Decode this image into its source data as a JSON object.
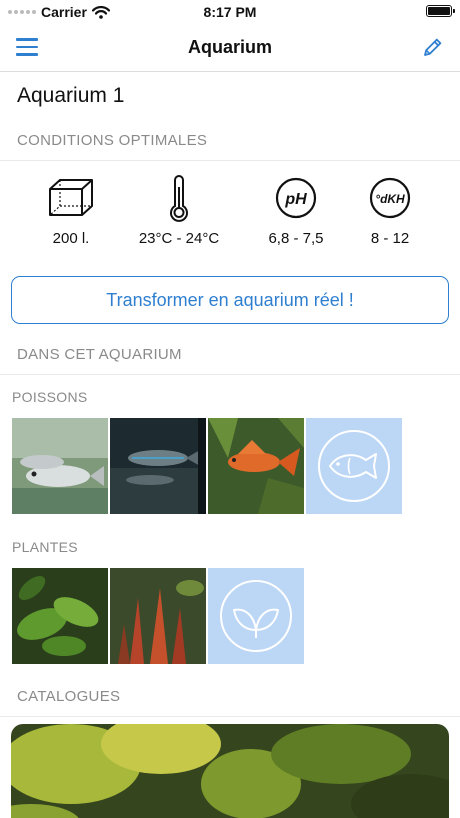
{
  "status_bar": {
    "carrier": "Carrier",
    "time": "8:17 PM"
  },
  "nav": {
    "title": "Aquarium",
    "menu_icon": "hamburger-menu-icon",
    "edit_icon": "pencil-icon"
  },
  "page_title": "Aquarium 1",
  "conditions": {
    "header": "CONDITIONS OPTIMALES",
    "items": [
      {
        "icon": "tank-volume-icon",
        "value": "200 l."
      },
      {
        "icon": "thermometer-icon",
        "value": "23°C - 24°C"
      },
      {
        "icon": "ph-icon",
        "value": "6,8 - 7,5",
        "label": "pH"
      },
      {
        "icon": "dkh-icon",
        "value": "8 - 12",
        "label": "°dKH"
      }
    ]
  },
  "transform_button": "Transformer en aquarium réel !",
  "in_aquarium": {
    "header": "DANS CET AQUARIUM",
    "fish": {
      "label": "POISSONS"
    },
    "plants": {
      "label": "PLANTES"
    }
  },
  "catalogs": {
    "header": "CATALOGUES"
  },
  "colors": {
    "accent": "#2f7fd0",
    "placeholder_bg": "#bcd6f5",
    "section_text": "#8a8a8a"
  }
}
